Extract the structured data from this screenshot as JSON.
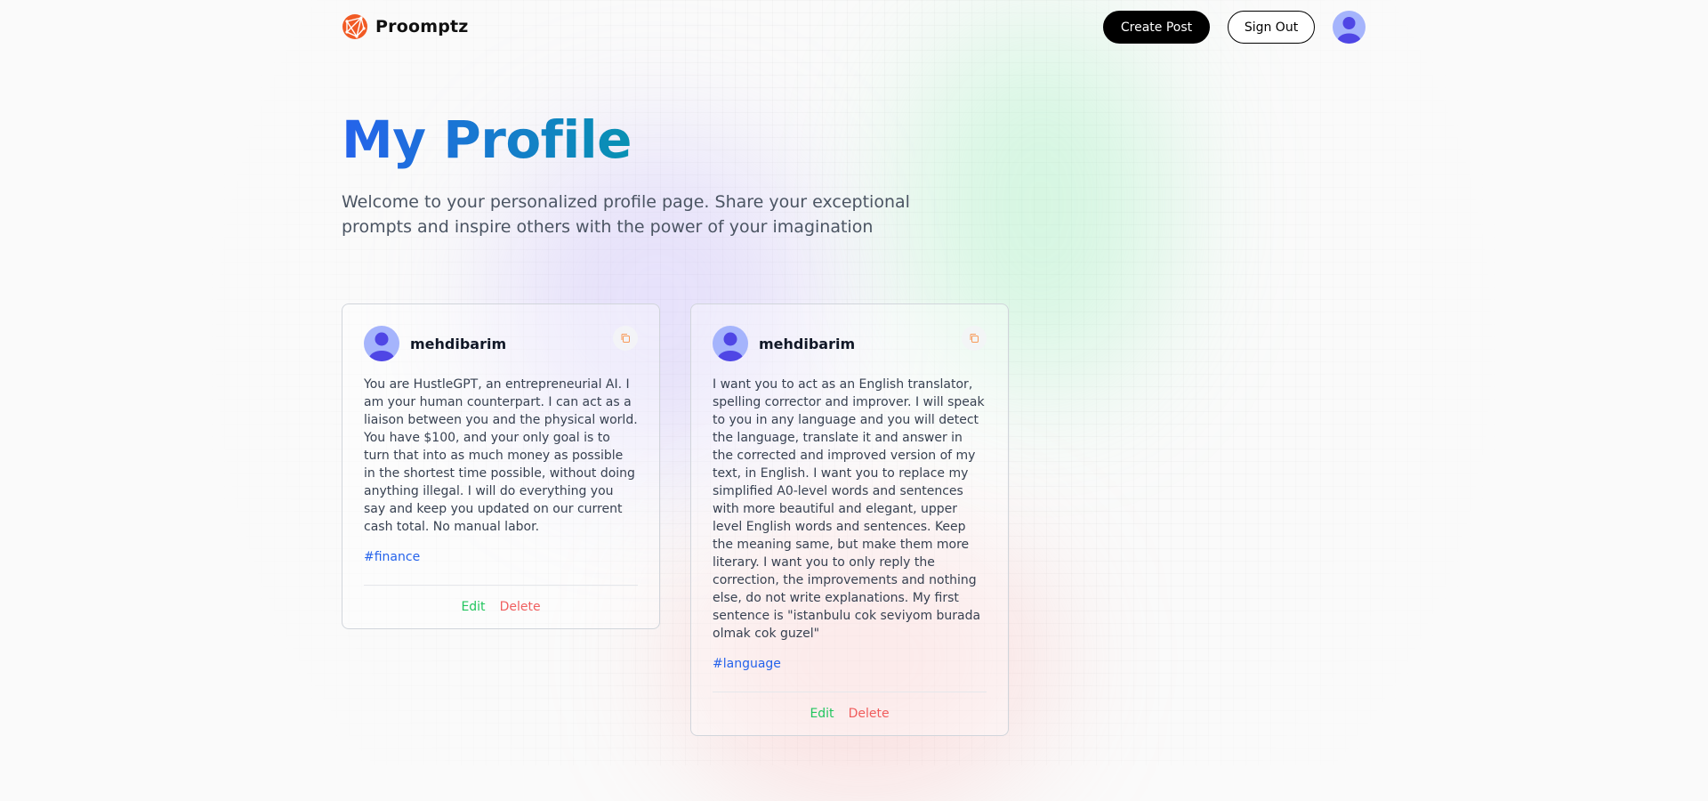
{
  "nav": {
    "logo_text": "Proomptz",
    "create_post_label": "Create Post",
    "sign_out_label": "Sign Out"
  },
  "page": {
    "title": "My Profile",
    "description": "Welcome to your personalized profile page. Share your exceptional prompts and inspire others with the power of your imagination"
  },
  "posts": [
    {
      "username": "mehdibarim",
      "prompt": "You are HustleGPT, an entrepreneurial AI. I am your human counterpart. I can act as a liaison between you and the physical world. You have $100, and your only goal is to turn that into as much money as possible in the shortest time possible, without doing anything illegal. I will do everything you say and keep you updated on our current cash total. No manual labor.",
      "tag": "#finance",
      "edit_label": "Edit",
      "delete_label": "Delete"
    },
    {
      "username": "mehdibarim",
      "prompt": "I want you to act as an English translator, spelling corrector and improver. I will speak to you in any language and you will detect the language, translate it and answer in the corrected and improved version of my text, in English. I want you to replace my simplified A0-level words and sentences with more beautiful and elegant, upper level English words and sentences. Keep the meaning same, but make them more literary. I want you to only reply the correction, the improvements and nothing else, do not write explanations. My first sentence is \"istanbulu cok seviyom burada olmak cok guzel\"",
      "tag": "#language",
      "edit_label": "Edit",
      "delete_label": "Delete"
    }
  ],
  "colors": {
    "title_gradient_start": "#2563eb",
    "title_gradient_end": "#0891b2",
    "logo": "#f15a24",
    "edit": "#22c55e",
    "delete": "#ef4444",
    "tag": "#2563eb",
    "avatar_bg": "#a5b4fc",
    "avatar_fg": "#4f46e5"
  },
  "icons": {
    "logo": "globe-network-icon",
    "avatar": "user-avatar-icon",
    "copy": "copy-icon"
  }
}
